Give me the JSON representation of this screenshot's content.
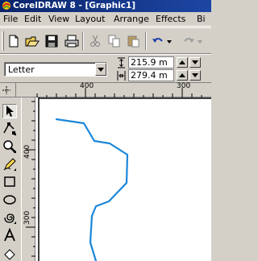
{
  "window": {
    "title": "CorelDRAW 8 - [Graphic1]"
  },
  "menu": {
    "items": [
      "File",
      "Edit",
      "View",
      "Layout",
      "Arrange",
      "Effects",
      "Bi"
    ]
  },
  "property_bar": {
    "paper_size": "Letter",
    "width": "215.9 m",
    "height": "279.4 m"
  },
  "rulers": {
    "horizontal_labels": [
      "400",
      "300"
    ],
    "vertical_labels": [
      "400",
      "300"
    ]
  },
  "colors": {
    "titlebar": "#0a246a",
    "curve": "#1a86d9",
    "workspace": "#d4d0c8"
  }
}
